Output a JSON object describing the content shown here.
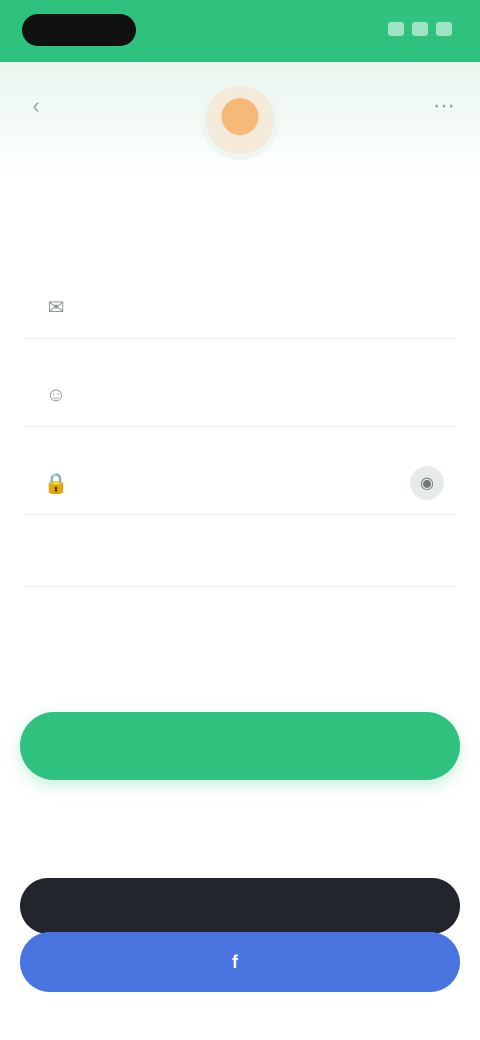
{
  "status_bar": {
    "time": ""
  },
  "title": {
    "prefix": "",
    "highlight": ""
  },
  "fields": {
    "email_placeholder": "",
    "username_placeholder": "",
    "password_placeholder": ""
  },
  "icons": {
    "back": "chevron-left-icon",
    "menu": "more-icon",
    "email": "mail-icon",
    "user": "user-icon",
    "password": "lock-icon",
    "eye": "eye-icon",
    "apple": "apple-icon",
    "facebook": "facebook-icon"
  },
  "links": {
    "forgot": ""
  },
  "terms": {
    "text": "",
    "link": ""
  },
  "buttons": {
    "login": "",
    "apple": "",
    "facebook": ""
  },
  "divider": {
    "or": ""
  },
  "colors": {
    "primary": "#2ec27e",
    "apple": "#22252b",
    "facebook": "#4a74e0"
  }
}
